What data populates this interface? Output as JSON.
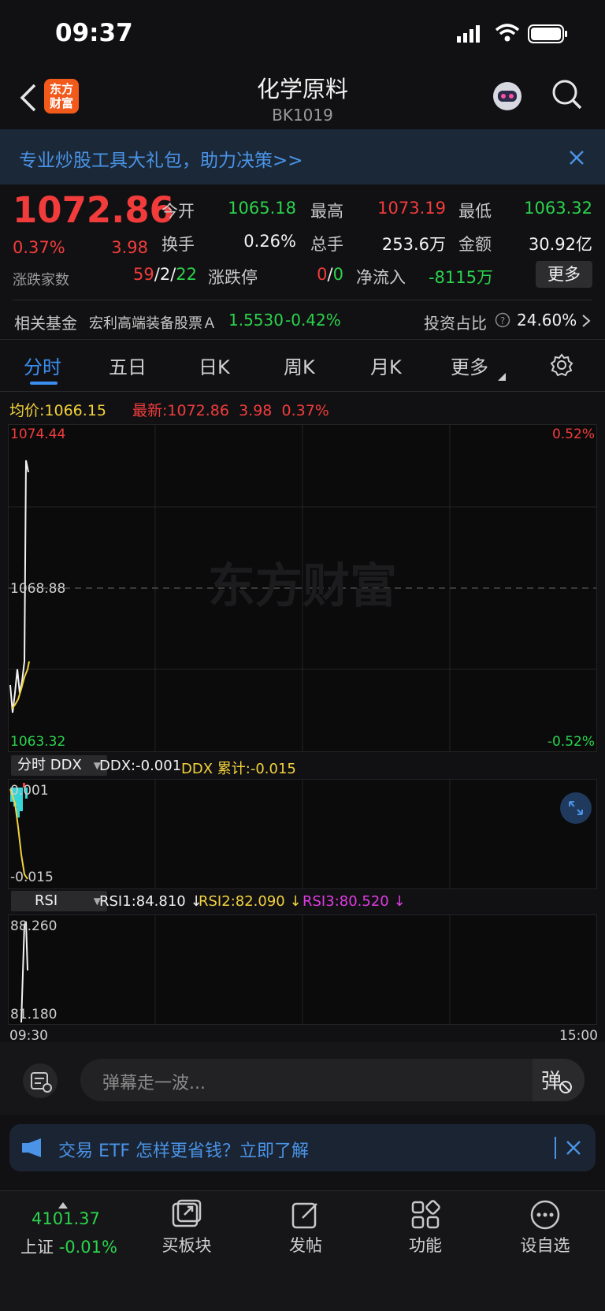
{
  "status": {
    "time": "09:37"
  },
  "header": {
    "title": "化学原料",
    "code": "BK1019",
    "logo_text": "东方财富"
  },
  "banner": {
    "text": "专业炒股工具大礼包，助力决策>>"
  },
  "quote": {
    "price": "1072.86",
    "change_pct": "0.37%",
    "change": "3.98",
    "open_label": "今开",
    "open": "1065.18",
    "high_label": "最高",
    "high": "1073.19",
    "low_label": "最低",
    "low": "1063.32",
    "turnover_label": "换手",
    "turnover": "0.26%",
    "volume_label": "总手",
    "volume": "253.6万",
    "amount_label": "金额",
    "amount": "30.92亿",
    "breadth_label": "涨跌家数",
    "breadth_up": "59",
    "breadth_flat": "2",
    "breadth_down": "22",
    "limit_label": "涨跌停",
    "limit_up": "0",
    "limit_down": "0",
    "netflow_label": "净流入",
    "netflow": "-8115万",
    "more_button": "更多"
  },
  "fund": {
    "label": "相关基金",
    "name": "宏利高端装备股票Ａ",
    "price": "1.5530",
    "change": "-0.42%",
    "ratio_label": "投资占比",
    "ratio": "24.60%"
  },
  "tabs": [
    "分时",
    "五日",
    "日K",
    "周K",
    "月K",
    "更多"
  ],
  "chart": {
    "avg_label": "均价:",
    "avg": "1066.15",
    "latest_label": "最新:",
    "latest": "1072.86",
    "latest_change": "3.98",
    "latest_pct": "0.37%",
    "y_max": "1074.44",
    "y_mid": "1068.88",
    "y_min": "1063.32",
    "pct_max": "0.52%",
    "pct_min": "-0.52%",
    "watermark": "东方财富",
    "time_start": "09:30",
    "time_end": "15:00"
  },
  "ddx": {
    "select": "分时 DDX",
    "ddx_text": "DDX:-0.001",
    "ddx_cum_text": "DDX 累计:-0.015",
    "y_max": "0.001",
    "y_min": "-0.015"
  },
  "rsi": {
    "select": "RSI",
    "rsi1": "RSI1:84.810 ↓",
    "rsi2": "RSI2:82.090 ↓",
    "rsi3": "RSI3:80.520 ↓",
    "y_max": "88.260",
    "y_min": "81.180"
  },
  "comment": {
    "placeholder": "弹幕走一波..."
  },
  "ad": {
    "text": "交易 ETF 怎样更省钱？立即了解"
  },
  "bottom": {
    "index_value": "4101.37",
    "index_name": "上证",
    "index_change": "-0.01%",
    "nav": [
      "买板块",
      "发帖",
      "功能",
      "设自选"
    ]
  },
  "colors": {
    "up": "#f23c3c",
    "down": "#2bd34d",
    "accent": "#3b8ef0",
    "avg_line": "#f3d23c"
  }
}
